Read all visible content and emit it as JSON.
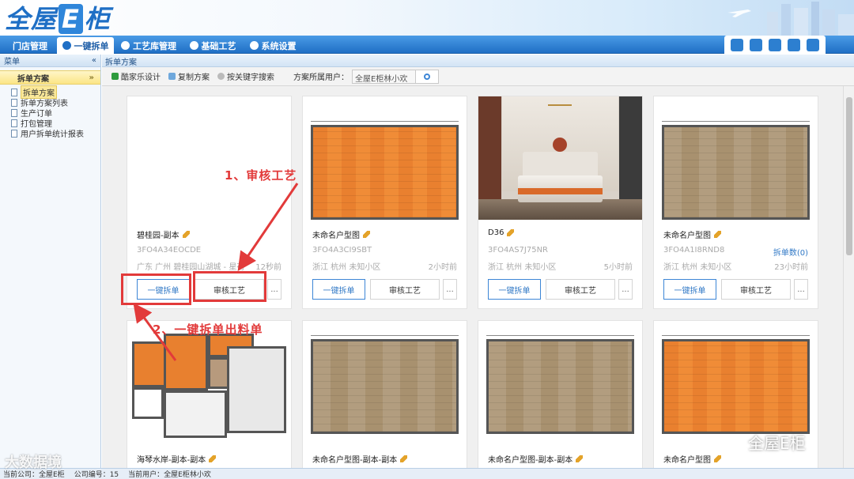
{
  "app": {
    "logo_text_a": "全屋",
    "logo_text_e": "E",
    "logo_text_b": "柜"
  },
  "nav": {
    "tabs": [
      {
        "label": "门店管理",
        "active": false
      },
      {
        "label": "一键拆单",
        "active": true
      },
      {
        "label": "工艺库管理",
        "active": false
      },
      {
        "label": "基础工艺",
        "active": false
      },
      {
        "label": "系统设置",
        "active": false
      }
    ]
  },
  "sidebar": {
    "header": "菜单",
    "collapse_icon": "«",
    "section": "拆单方案",
    "section_icon": "»",
    "items": [
      {
        "label": "拆单方案"
      },
      {
        "label": "拆单方案列表"
      },
      {
        "label": "生产订单"
      },
      {
        "label": "打包管理"
      },
      {
        "label": "用户拆单统计报表"
      }
    ]
  },
  "breadcrumb": "拆单方案",
  "toolbar": {
    "kujiale": "酷家乐设计",
    "copy": "复制方案",
    "keyword": "按关键字搜索",
    "owner_label": "方案所属用户：",
    "owner_value": "全屋E柜林小欢"
  },
  "cards": [
    {
      "title": "碧桂园-副本",
      "code": "3FO4A34EOCDE",
      "location": "广东 广州 碧桂园山湖城 - 星荷",
      "time": "12秒前",
      "count": "",
      "thumb": "blank"
    },
    {
      "title": "未命名户型图",
      "code": "3FO4A3CI9SBT",
      "location": "浙江 杭州 未知小区",
      "time": "2小时前",
      "count": "",
      "thumb": "orange"
    },
    {
      "title": "D36",
      "code": "3FO4AS7J75NR",
      "location": "浙江 杭州 未知小区",
      "time": "5小时前",
      "count": "",
      "thumb": "photo"
    },
    {
      "title": "未命名户型图",
      "code": "3FO4A1I8RND8",
      "location": "浙江 杭州 未知小区",
      "time": "23小时前",
      "count": "拆单数(0)",
      "thumb": "wood"
    },
    {
      "title": "海琴水岸-副本-副本",
      "thumb": "floorplan"
    },
    {
      "title": "未命名户型图-副本-副本",
      "thumb": "wood"
    },
    {
      "title": "未命名户型图-副本-副本",
      "thumb": "wood"
    },
    {
      "title": "未命名户型图",
      "thumb": "orange"
    }
  ],
  "buttons": {
    "one_key": "一键拆单",
    "audit": "审核工艺",
    "more": "..."
  },
  "annotations": {
    "step1": "1、审核工艺",
    "step2": "2、一键拆单出料单"
  },
  "status": {
    "company": "当前公司：全屋E柜",
    "company_no": "公司编号：15",
    "user": "当前用户：全屋E柜林小欢"
  },
  "watermark": {
    "left": "大数据境",
    "right": "全屋E柜"
  },
  "colors": {
    "brand": "#1f6fc5",
    "annotation": "#e23a3a",
    "link": "#3179c6"
  }
}
